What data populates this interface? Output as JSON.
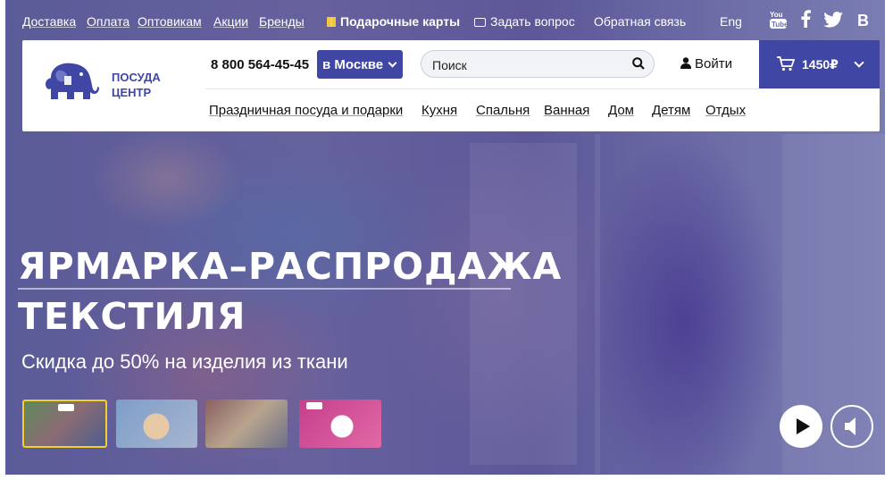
{
  "topbar": {
    "links": [
      "Доставка",
      "Оплата",
      "Оптовикам",
      "Акции",
      "Бренды"
    ],
    "gift_cards": "Подарочные карты",
    "ask_question": "Задать вопрос",
    "feedback": "Обратная связь",
    "lang": "Eng",
    "social": [
      "youtube-icon",
      "facebook-icon",
      "twitter-icon",
      "vk-icon"
    ],
    "social_vk_label": "В"
  },
  "header": {
    "logo_line1": "ПОСУДА",
    "logo_line2": "ЦЕНТР",
    "phone": "8 800 564-45-45",
    "city": "в Москве",
    "search_placeholder": "Поиск",
    "login": "Войти",
    "cart_amount": "1450₽",
    "nav": [
      "Праздничная посуда и подарки",
      "Кухня",
      "Спальня",
      "Ванная",
      "Дом",
      "Детям",
      "Отдых"
    ]
  },
  "hero": {
    "title_line1": "ЯРМАРКА–РАСПРОДАЖА",
    "title_line2": "ТЕКСТИЛЯ",
    "subtitle": "Скидка до 50% на изделия из ткани",
    "thumbnails_count": 4,
    "active_thumbnail": 1
  },
  "colors": {
    "brand": "#3f46a3",
    "accent_yellow": "#f2d02c"
  }
}
